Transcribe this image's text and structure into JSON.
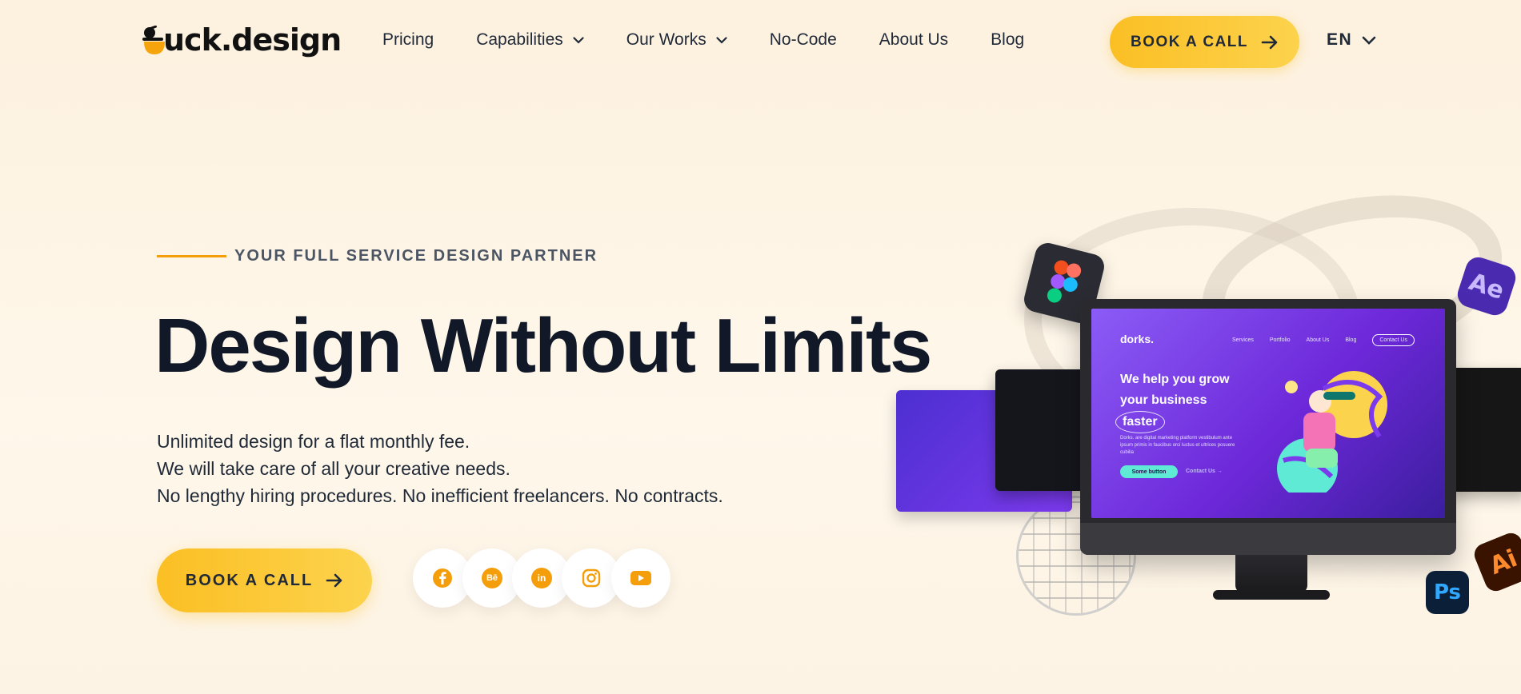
{
  "brand": {
    "logo_text": "uck.design",
    "logo_full": "duck.design",
    "accent": "#fbbf24",
    "orange": "#f59e0b"
  },
  "nav": {
    "items": [
      {
        "label": "Pricing",
        "dropdown": false
      },
      {
        "label": "Capabilities",
        "dropdown": true
      },
      {
        "label": "Our Works",
        "dropdown": true
      },
      {
        "label": "No-Code",
        "dropdown": false
      },
      {
        "label": "About Us",
        "dropdown": false
      },
      {
        "label": "Blog",
        "dropdown": false
      }
    ],
    "cta_label": "BOOK A CALL",
    "language": "EN"
  },
  "hero": {
    "eyebrow": "YOUR FULL SERVICE DESIGN PARTNER",
    "headline": "Design Without Limits",
    "lines": [
      "Unlimited design for a flat monthly fee.",
      "We will take care of all your creative needs.",
      "No lengthy hiring procedures. No inefficient freelancers. No contracts."
    ],
    "cta_label": "BOOK A CALL",
    "socials": [
      {
        "name": "facebook-icon"
      },
      {
        "name": "behance-icon",
        "glyph": "Bē"
      },
      {
        "name": "linkedin-icon",
        "glyph": "in"
      },
      {
        "name": "instagram-icon"
      },
      {
        "name": "youtube-icon"
      }
    ]
  },
  "illustration": {
    "app_icons": {
      "ae": "Ae",
      "ai": "Ai",
      "ps": "Ps"
    },
    "screen": {
      "logo": "dorks.",
      "nav": [
        "Services",
        "Portfolio",
        "About Us",
        "Blog"
      ],
      "nav_pill": "Contact Us",
      "headline_1": "We help you grow",
      "headline_2": "your business",
      "headline_3": "faster",
      "sub": "Dorks. are digital marketing platform vestibulum ante ipsum primis in faucibus orci luctus et ultrices posuere cubilia",
      "button": "Some button",
      "link": "Contact Us →"
    }
  }
}
